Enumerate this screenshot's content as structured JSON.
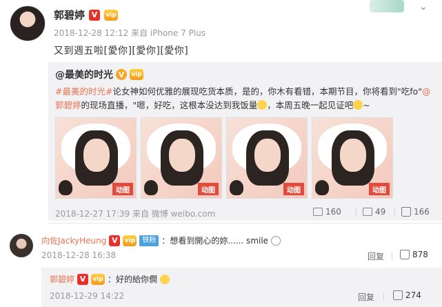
{
  "post": {
    "author": "郭碧婷",
    "meta": "2018-12-28 12:12 来自 iPhone 7 Plus",
    "text": "又到週五啦[愛你][愛你][愛你]"
  },
  "repost": {
    "author": "@最美的时光",
    "tag": "#最美的时光#",
    "text_a": "论女神如何优雅的展现吃货本质，是的，你木有看错，本期节目，你将看到\"吃fo\"",
    "mention": "@郭碧婷",
    "text_b": "的现场直播，\"嗯，好吃，这根本没达到我饭量",
    "text_c": "，本周五晚一起见证吧",
    "text_d": "~",
    "thumb_labels": [
      "动图",
      "动图",
      "动图",
      "动图"
    ],
    "meta": "2018-12-27 17:39 来自 微博 weibo.com",
    "reposts": "160",
    "comments": "49",
    "likes": "166"
  },
  "comment": {
    "user": "向佐JackyHeung",
    "fan_badge": "铁粉",
    "text": "：想看到開心的妳...... smile",
    "time": "2018-12-28 16:38",
    "reply_label": "回复",
    "likes": "878"
  },
  "reply": {
    "user": "郭碧婷",
    "text": "：好的給你僴",
    "time": "2018-12-29 14:22",
    "reply_label": "回复",
    "likes": "274"
  },
  "icons": {
    "verified": "V",
    "vip": "vip"
  },
  "colors": {
    "accent": "#eb7350",
    "verified_orange": "#f6a623",
    "fan_badge": "#4aa3df"
  }
}
